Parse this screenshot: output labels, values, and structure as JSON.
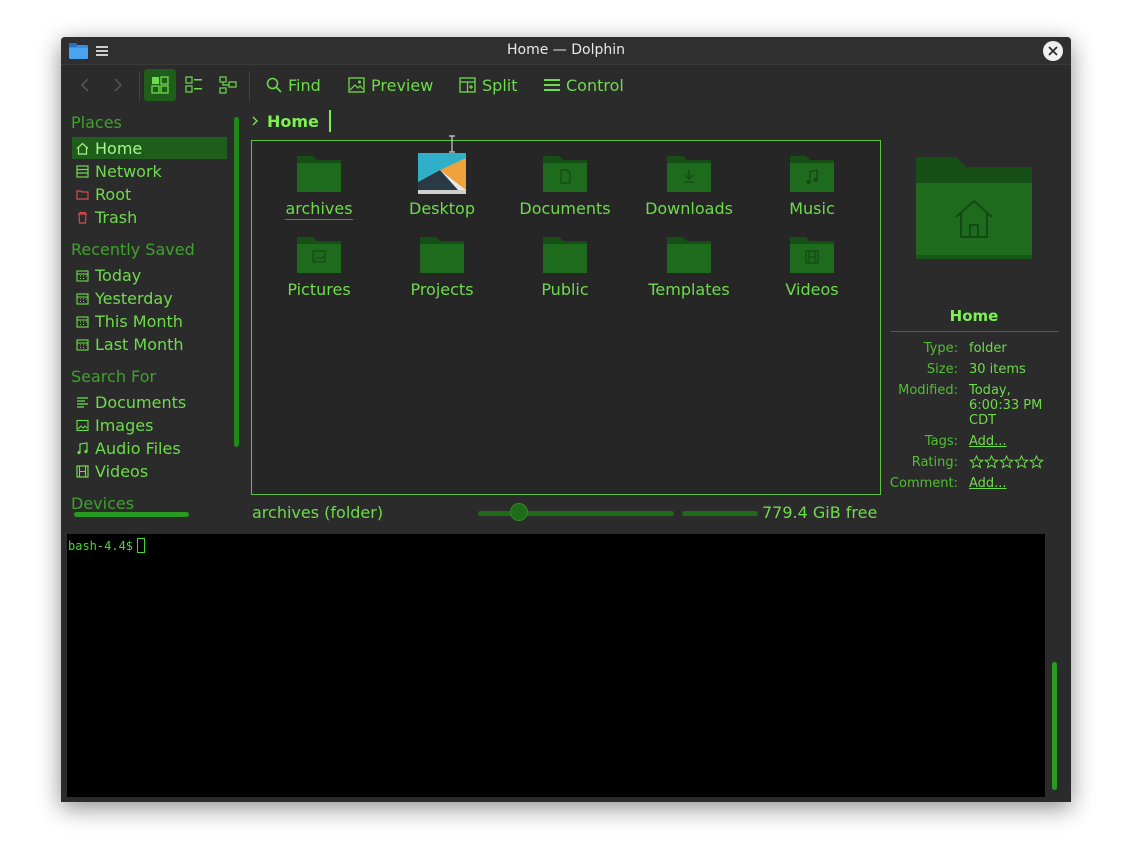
{
  "window": {
    "title": "Home — Dolphin"
  },
  "toolbar": {
    "find_label": "Find",
    "preview_label": "Preview",
    "split_label": "Split",
    "control_label": "Control"
  },
  "sidebar": {
    "places_heading": "Places",
    "places": [
      {
        "label": "Home",
        "icon": "home-icon"
      },
      {
        "label": "Network",
        "icon": "network-icon"
      },
      {
        "label": "Root",
        "icon": "root-folder-icon"
      },
      {
        "label": "Trash",
        "icon": "trash-icon"
      }
    ],
    "recent_heading": "Recently Saved",
    "recent": [
      {
        "label": "Today",
        "icon": "calendar-icon"
      },
      {
        "label": "Yesterday",
        "icon": "calendar-icon"
      },
      {
        "label": "This Month",
        "icon": "calendar-icon"
      },
      {
        "label": "Last Month",
        "icon": "calendar-icon"
      }
    ],
    "search_heading": "Search For",
    "search": [
      {
        "label": "Documents",
        "icon": "document-icon"
      },
      {
        "label": "Images",
        "icon": "image-icon"
      },
      {
        "label": "Audio Files",
        "icon": "music-note-icon"
      },
      {
        "label": "Videos",
        "icon": "film-icon"
      }
    ],
    "devices_heading": "Devices"
  },
  "breadcrumb": {
    "current": "Home"
  },
  "files": [
    {
      "name": "archives"
    },
    {
      "name": "Desktop"
    },
    {
      "name": "Documents"
    },
    {
      "name": "Downloads"
    },
    {
      "name": "Music"
    },
    {
      "name": "Pictures"
    },
    {
      "name": "Projects"
    },
    {
      "name": "Public"
    },
    {
      "name": "Templates"
    },
    {
      "name": "Videos"
    }
  ],
  "info_panel": {
    "title": "Home",
    "type_key": "Type:",
    "type_val": "folder",
    "size_key": "Size:",
    "size_val": "30 items",
    "modified_key": "Modified:",
    "modified_val": "Today, 6:00:33 PM CDT",
    "tags_key": "Tags:",
    "tags_val": "Add...",
    "rating_key": "Rating:",
    "rating_stars": 0,
    "comment_key": "Comment:",
    "comment_val": "Add..."
  },
  "statusbar": {
    "selection": "archives (folder)",
    "zoom_fraction": 0.2,
    "free_space": "779.4 GiB free"
  },
  "terminal": {
    "prompt": "bash-4.4$"
  },
  "colors": {
    "accent": "#6ddc4a",
    "selection": "#1f5e1a",
    "folder": "#1e6b1e",
    "folder_dark": "#154f15",
    "terminal_bg": "#000000"
  }
}
